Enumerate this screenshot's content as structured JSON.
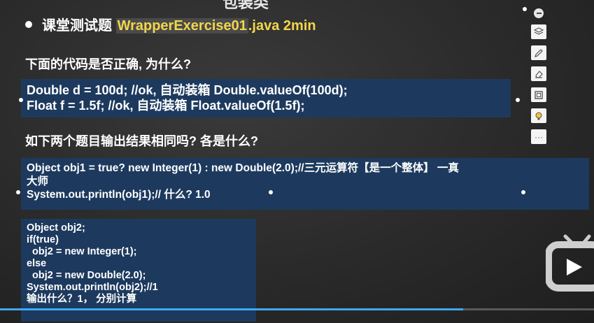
{
  "slide": {
    "top_title": "包装类",
    "bullet_prefix": "课堂测试题",
    "bullet_file": "WrapperExercise01",
    "bullet_suffix": ".java 2min",
    "q1": "下面的代码是否正确, 为什么?",
    "box1_lines": [
      "Double d = 100d; //ok, 自动装箱 Double.valueOf(100d);",
      "Float f = 1.5f; //ok, 自动装箱 Float.valueOf(1.5f);"
    ],
    "q2": "如下两个题目输出结果相同吗? 各是什么?",
    "box2_lines": [
      "Object obj1 = true? new Integer(1) : new Double(2.0);//三元运算符【是一个整体】 一真",
      "大师",
      "System.out.println(obj1);// 什么? 1.0"
    ],
    "box3_lines": [
      "Object obj2;",
      "if(true)",
      "  obj2 = new Integer(1);",
      "else",
      "  obj2 = new Double(2.0);",
      "System.out.println(obj2);//1",
      "输出什么？1， 分别计算"
    ]
  },
  "toolbar": {
    "icons": [
      "minus-icon",
      "layers-icon",
      "pen-icon",
      "eraser-icon",
      "frame-icon",
      "bulb-icon",
      "more-icon"
    ],
    "more_label": "···"
  },
  "player": {
    "progress": 0.78
  },
  "colors": {
    "code_bg": "#1d3a5e",
    "highlight": "#f1d74a",
    "progress": "#3fa9f5"
  }
}
